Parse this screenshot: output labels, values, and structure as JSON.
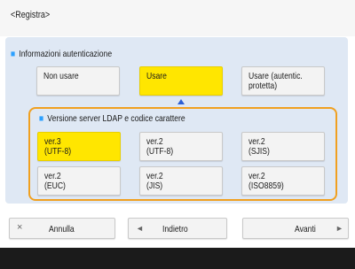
{
  "header": {
    "title": "<Registra>"
  },
  "auth": {
    "label": "Informazioni autenticazione",
    "options": [
      {
        "label": "Non usare",
        "selected": false
      },
      {
        "label": "Usare",
        "selected": true
      },
      {
        "label": "Usare (autentic.\nprotetta)",
        "selected": false
      }
    ]
  },
  "ldap": {
    "label": "Versione server LDAP e codice carattere",
    "options": [
      {
        "label": "ver.3\n(UTF-8)",
        "selected": true
      },
      {
        "label": "ver.2\n(UTF-8)",
        "selected": false
      },
      {
        "label": "ver.2\n(SJIS)",
        "selected": false
      },
      {
        "label": "ver.2\n(EUC)",
        "selected": false
      },
      {
        "label": "ver.2\n(JIS)",
        "selected": false
      },
      {
        "label": "ver.2\n(ISO8859)",
        "selected": false
      }
    ]
  },
  "footer": {
    "cancel": {
      "label": "Annulla",
      "icon": "×"
    },
    "back": {
      "label": "Indietro",
      "icon": "◄"
    },
    "next": {
      "label": "Avanti",
      "icon": "►"
    }
  },
  "colors": {
    "selected": "#ffe600",
    "highlight_border": "#f0a020",
    "panel_bg": "#dfe8f4",
    "bullet": "#2ca0ff"
  }
}
